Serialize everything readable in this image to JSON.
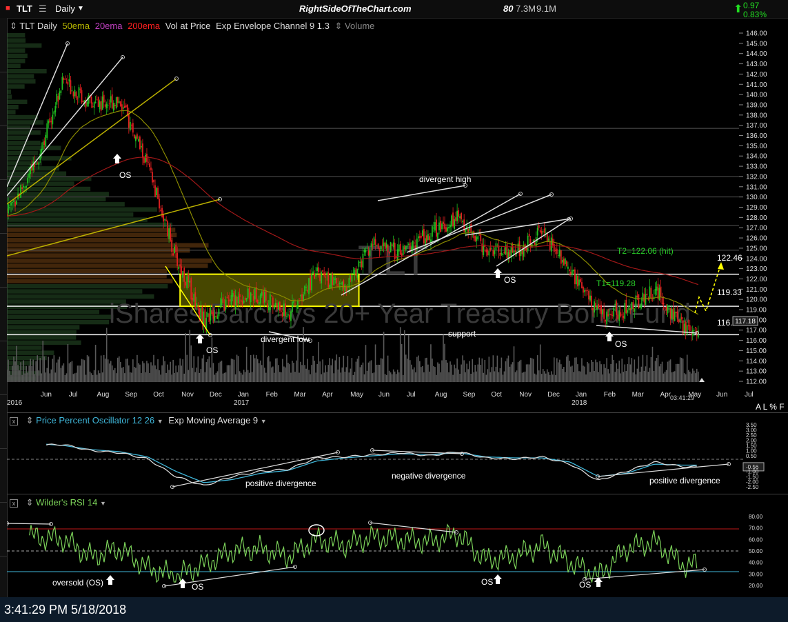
{
  "toolbar": {
    "symbol": "TLT",
    "interval": "Daily",
    "site": "RightSideOfTheChart.com",
    "stat_num": "80",
    "stat_vol1": "7.3M",
    "stat_vol2": "9.1M",
    "change_abs": "0.97",
    "change_pct": "0.83%"
  },
  "main_legend": {
    "symbol": "TLT Daily",
    "ema50": "50ema",
    "ema20": "20ema",
    "ema200": "200ema",
    "vap": "Vol at Price",
    "env": "Exp Envelope Channel 9 1.3",
    "volume": "Volume"
  },
  "watermark": {
    "ticker": "TLT",
    "name": "iShares Barclays 20+ Year Treasury Bond Fund"
  },
  "price_axis": {
    "ticks": [
      "146.00",
      "145.00",
      "144.00",
      "143.00",
      "142.00",
      "141.00",
      "140.00",
      "139.00",
      "138.00",
      "137.00",
      "136.00",
      "135.00",
      "134.00",
      "133.00",
      "132.00",
      "131.00",
      "130.00",
      "129.00",
      "128.00",
      "127.00",
      "126.00",
      "125.00",
      "124.00",
      "123.00",
      "122.00",
      "121.00",
      "120.00",
      "119.00",
      "118.00",
      "117.00",
      "116.00",
      "115.00",
      "114.00",
      "113.00",
      "112.00"
    ],
    "last_price": "117.18"
  },
  "time_axis": {
    "labels": [
      "2016",
      "Jun",
      "Jul",
      "Aug",
      "Sep",
      "Oct",
      "Nov",
      "Dec",
      "Jan",
      "2017",
      "Feb",
      "Mar",
      "Apr",
      "May",
      "Jun",
      "Jul",
      "Aug",
      "Sep",
      "Oct",
      "Nov",
      "Dec",
      "Jan",
      "2018",
      "Feb",
      "Mar",
      "Apr",
      "May",
      "Jun",
      "Jul"
    ],
    "clock": "03:41:29",
    "corner": "A L % F"
  },
  "annotations": {
    "divergent_high": "divergent high",
    "divergent_low": "divergent low",
    "support": "support",
    "os": "OS",
    "t1": "T1=119.28",
    "t2": "T2=122.06 (hit)",
    "level_122": "122.46",
    "level_119": "119.33",
    "level_116": "116.56",
    "positive_divergence": "positive divergence",
    "negative_divergence": "negative divergence",
    "oversold_os": "oversold (OS)"
  },
  "ppo": {
    "title": "Price Percent Oscillator 12 26",
    "ma": "Exp Moving Average 9",
    "ticks": [
      "3.50",
      "3.00",
      "2.50",
      "2.00",
      "1.50",
      "1.00",
      "0.50",
      "-0.56",
      "-1.00",
      "-1.50",
      "-2.00",
      "-2.50"
    ]
  },
  "rsi": {
    "title": "Wilder's RSI 14",
    "ticks": [
      "80.00",
      "70.00",
      "60.00",
      "50.00",
      "40.00",
      "30.00",
      "20.00"
    ]
  },
  "status": {
    "timestamp": "3:41:29 PM 5/18/2018"
  },
  "colors": {
    "up": "#20c020",
    "down": "#e02020",
    "ema50": "#b7b700",
    "ema20": "#c040c0",
    "ema200": "#ff2020",
    "yellow_box": "#ffff00",
    "rsi_line": "#7cd35a",
    "ppo_line": "#d9d9d9",
    "ppo_signal": "#3fb6d9"
  },
  "chart_data": [
    {
      "type": "candlestick",
      "title": "TLT Daily",
      "ylim": [
        112,
        146
      ],
      "x_range": [
        "2016-05",
        "2018-07"
      ],
      "series": [
        {
          "name": "TLT",
          "x": [
            "2016-05",
            "2016-06",
            "2016-07",
            "2016-08",
            "2016-09",
            "2016-10",
            "2016-11",
            "2016-12",
            "2017-01",
            "2017-02",
            "2017-03",
            "2017-04",
            "2017-05",
            "2017-06",
            "2017-07",
            "2017-08",
            "2017-09",
            "2017-10",
            "2017-11",
            "2017-12",
            "2018-01",
            "2018-02",
            "2018-03",
            "2018-04",
            "2018-05"
          ],
          "values": [
            128.5,
            133.0,
            141.5,
            139.0,
            139.5,
            133.0,
            124.0,
            118.0,
            120.0,
            120.5,
            118.5,
            122.5,
            121.0,
            125.5,
            124.5,
            126.5,
            128.0,
            125.0,
            124.5,
            126.5,
            123.0,
            118.5,
            119.0,
            121.0,
            117.2
          ]
        }
      ],
      "horizontal_levels": [
        136.7,
        132.0,
        130.0,
        127.2,
        124.8,
        122.46,
        119.33,
        116.56
      ],
      "box": {
        "x": [
          "2016-11",
          "2017-05"
        ],
        "y": [
          119.33,
          122.46
        ]
      }
    },
    {
      "type": "line",
      "title": "Price Percent Oscillator 12 26",
      "ylim": [
        -2.5,
        3.5
      ],
      "series": [
        {
          "name": "Price Percent Oscillator 12 26",
          "x": [
            "2016-05",
            "2016-06",
            "2016-07",
            "2016-08",
            "2016-09",
            "2016-10",
            "2016-11",
            "2016-12",
            "2017-01",
            "2017-02",
            "2017-03",
            "2017-04",
            "2017-05",
            "2017-06",
            "2017-07",
            "2017-08",
            "2017-09",
            "2017-10",
            "2017-11",
            "2017-12",
            "2018-01",
            "2018-02",
            "2018-03",
            "2018-04",
            "2018-05"
          ],
          "values": [
            2.2,
            1.5,
            1.6,
            1.0,
            0.8,
            0.2,
            -1.5,
            -2.4,
            -1.5,
            -1.0,
            -0.8,
            0.3,
            0.4,
            0.6,
            0.8,
            0.5,
            0.9,
            0.3,
            0.2,
            0.4,
            -0.3,
            -1.9,
            -1.0,
            -0.1,
            -0.56
          ]
        },
        {
          "name": "Exp Moving Average 9",
          "x": [
            "2016-05",
            "2016-06",
            "2016-07",
            "2016-08",
            "2016-09",
            "2016-10",
            "2016-11",
            "2016-12",
            "2017-01",
            "2017-02",
            "2017-03",
            "2017-04",
            "2017-05",
            "2017-06",
            "2017-07",
            "2017-08",
            "2017-09",
            "2017-10",
            "2017-11",
            "2017-12",
            "2018-01",
            "2018-02",
            "2018-03",
            "2018-04",
            "2018-05"
          ],
          "values": [
            2.0,
            1.7,
            1.5,
            1.1,
            0.9,
            0.4,
            -1.0,
            -2.1,
            -1.8,
            -1.2,
            -0.9,
            0.0,
            0.3,
            0.5,
            0.7,
            0.6,
            0.8,
            0.4,
            0.3,
            0.3,
            -0.1,
            -1.5,
            -1.2,
            -0.3,
            -0.4
          ]
        }
      ]
    },
    {
      "type": "line",
      "title": "Wilder's RSI 14",
      "ylim": [
        20,
        80
      ],
      "series": [
        {
          "name": "Wilder's RSI 14",
          "x": [
            "2016-05",
            "2016-06",
            "2016-07",
            "2016-08",
            "2016-09",
            "2016-10",
            "2016-11",
            "2016-12",
            "2017-01",
            "2017-02",
            "2017-03",
            "2017-04",
            "2017-05",
            "2017-06",
            "2017-07",
            "2017-08",
            "2017-09",
            "2017-10",
            "2017-11",
            "2017-12",
            "2018-01",
            "2018-02",
            "2018-03",
            "2018-04",
            "2018-05"
          ],
          "values": [
            70,
            62,
            60,
            45,
            52,
            35,
            28,
            38,
            50,
            52,
            45,
            60,
            55,
            62,
            60,
            58,
            65,
            42,
            45,
            55,
            40,
            28,
            52,
            58,
            38
          ]
        }
      ],
      "reference_levels": [
        70,
        50,
        30
      ]
    }
  ]
}
